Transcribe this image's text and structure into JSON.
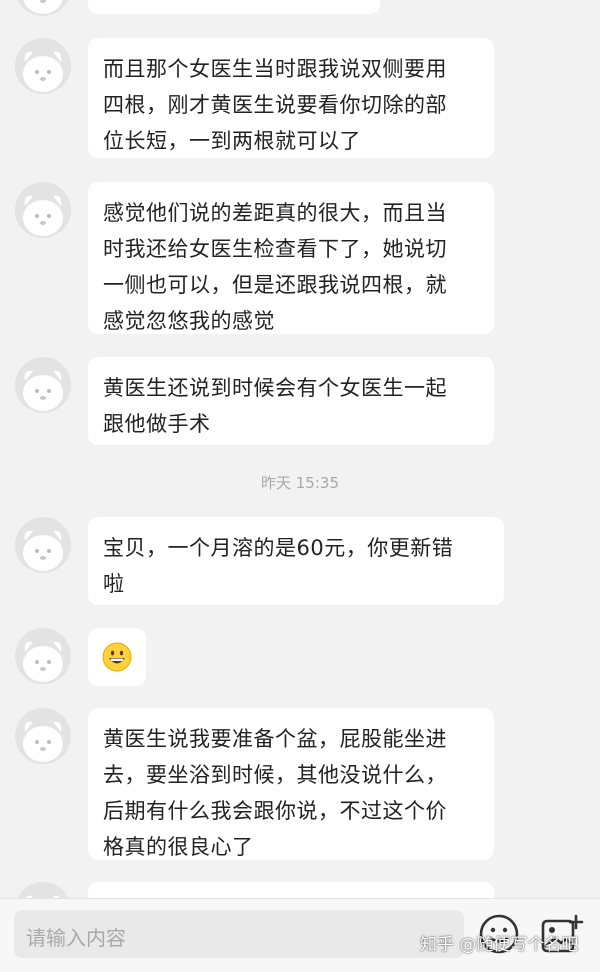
{
  "messages": [
    {
      "lines": [
        "而且那个女医生当时跟我说双侧要用",
        "四根，刚才黄医生说要看你切除的部",
        "位长短，一到两根就可以了"
      ]
    },
    {
      "lines": [
        "感觉他们说的差距真的很大，而且当",
        "时我还给女医生检查看下了，她说切",
        "一侧也可以，但是还跟我说四根，就",
        "感觉忽悠我的感觉"
      ]
    },
    {
      "lines": [
        "黄医生还说到时候会有个女医生一起",
        "跟他做手术"
      ]
    },
    {
      "lines": [
        "宝贝，一个月溶的是60元，你更新错",
        "啦"
      ]
    },
    {
      "emoji": "grinning-face"
    },
    {
      "lines": [
        "黄医生说我要准备个盆，屁股能坐进",
        "去，要坐浴到时候，其他没说什么，",
        "后期有什么我会跟你说，不过这个价",
        "格真的很良心了"
      ]
    }
  ],
  "timestamp": "昨天 15:35",
  "input": {
    "placeholder": "请输入内容"
  },
  "toolbar": {
    "emoji_icon": "smiley-icon",
    "image_icon": "add-image-icon"
  },
  "watermark": "知乎 @随便写个名吧",
  "colors": {
    "background": "#f2f2f2",
    "bubble": "#ffffff",
    "text": "#222222",
    "timestamp": "#a8a8a8",
    "placeholder": "#a9a9a9"
  }
}
